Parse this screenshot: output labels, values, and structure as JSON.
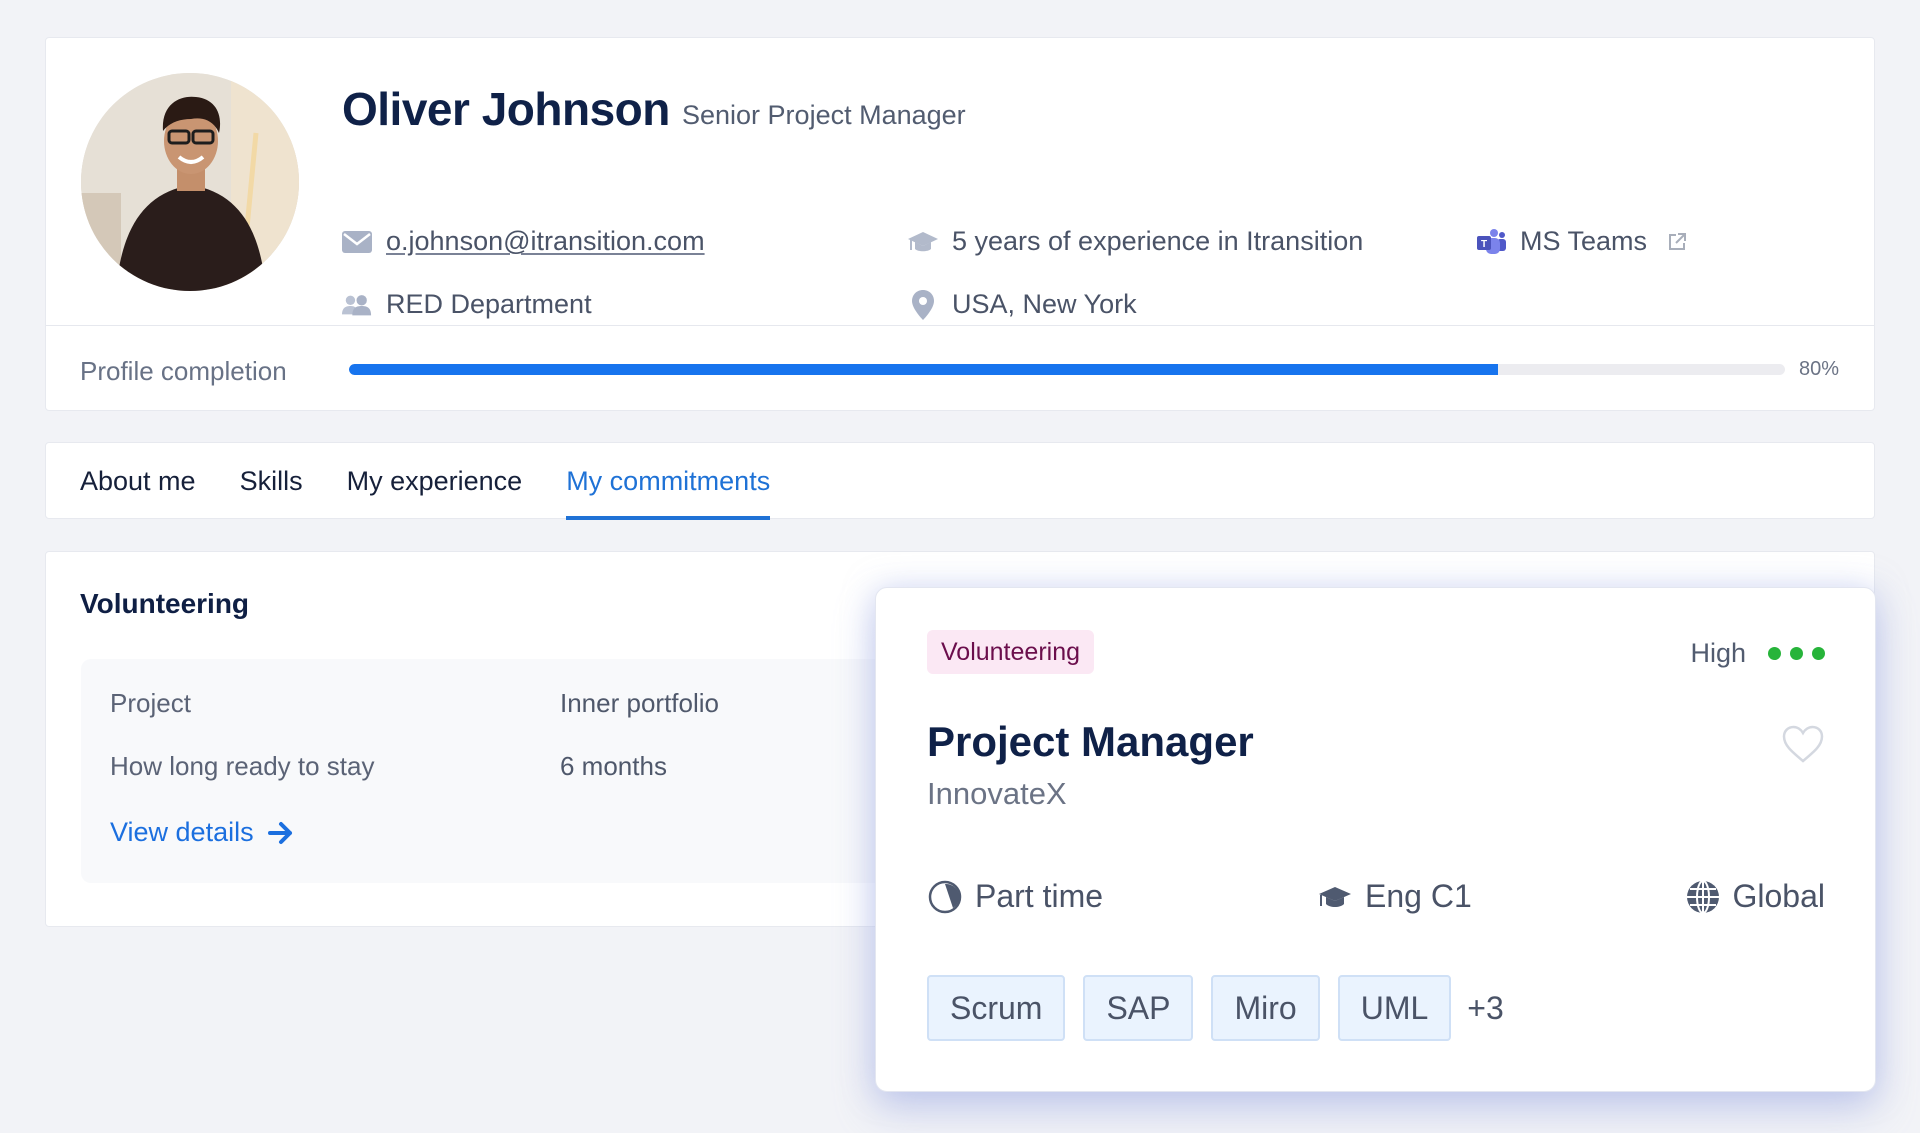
{
  "profile": {
    "name": "Oliver Johnson",
    "role": "Senior Project Manager",
    "email": "o.johnson@itransition.com",
    "department": "RED Department",
    "experience": "5 years of experience in Itransition",
    "location": "USA, New York",
    "messenger": "MS Teams",
    "icons": {
      "email": "envelope-icon",
      "department": "users-icon",
      "experience": "graduation-cap-icon",
      "location": "map-pin-icon",
      "messenger": "ms-teams-icon",
      "external": "external-link-icon"
    }
  },
  "completion": {
    "label": "Profile completion",
    "percent": 80,
    "percent_label": "80%",
    "color": "#1774ee"
  },
  "tabs": [
    {
      "label": "About me",
      "active": false
    },
    {
      "label": "Skills",
      "active": false
    },
    {
      "label": "My experience",
      "active": false
    },
    {
      "label": "My commitments",
      "active": true
    }
  ],
  "volunteering": {
    "title": "Volunteering",
    "rows": [
      {
        "label": "Project",
        "value": "Inner portfolio"
      },
      {
        "label": "How long ready to stay",
        "value": "6 months"
      }
    ],
    "view_details": "View details"
  },
  "job_card": {
    "badge": "Volunteering",
    "priority": "High",
    "priority_level": 3,
    "priority_color": "#27b43a",
    "title": "Project Manager",
    "company": "InnovateX",
    "attributes": [
      {
        "icon": "clock-pie-icon",
        "label": "Part time"
      },
      {
        "icon": "graduation-cap-icon",
        "label": "Eng C1"
      },
      {
        "icon": "globe-icon",
        "label": "Global"
      }
    ],
    "tags": [
      "Scrum",
      "SAP",
      "Miro",
      "UML"
    ],
    "more_tags": "+3",
    "favorite": false
  }
}
